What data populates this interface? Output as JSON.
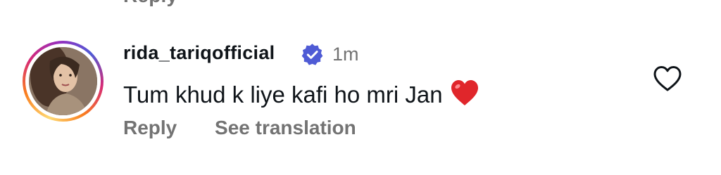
{
  "previous_comment": {
    "reply_label": "Reply"
  },
  "comment": {
    "username": "rida_tariqofficial",
    "verified": true,
    "timestamp": "1m",
    "text": "Tum khud k liye kafi ho mri Jan",
    "emoji": "red-heart",
    "actions": {
      "reply_label": "Reply",
      "translate_label": "See translation"
    },
    "liked": false
  },
  "colors": {
    "text_primary": "#0f1419",
    "text_secondary": "#737373",
    "verified_blue": "#4f5bd5",
    "heart_red": "#e0262b"
  },
  "icons": {
    "verified": "verified-badge-icon",
    "like": "heart-outline-icon",
    "emoji": "red-heart-emoji-icon"
  }
}
